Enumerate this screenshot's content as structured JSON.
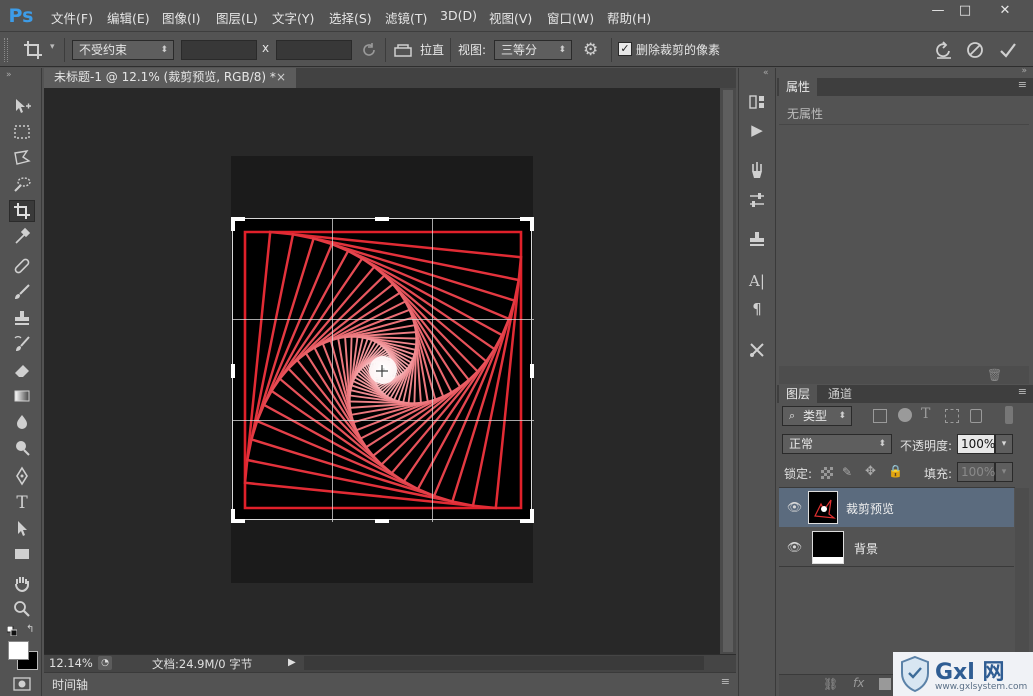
{
  "app": {
    "logo": "Ps"
  },
  "menu": [
    "文件(F)",
    "编辑(E)",
    "图像(I)",
    "图层(L)",
    "文字(Y)",
    "选择(S)",
    "滤镜(T)",
    "3D(D)",
    "视图(V)",
    "窗口(W)",
    "帮助(H)"
  ],
  "window_controls": {
    "minimize": "—",
    "maximize": "□",
    "close": "✕"
  },
  "options": {
    "ratio_select": "不受约束",
    "width_value": "",
    "x_label": "x",
    "height_value": "",
    "straighten_label": "拉直",
    "view_label": "视图:",
    "view_select": "三等分",
    "delete_pixels_label": "删除裁剪的像素",
    "delete_pixels_checked": true
  },
  "document": {
    "tab_title": "未标题-1 @ 12.1% (裁剪预览, RGB/8) *",
    "close": "×",
    "zoom": "12.14%",
    "doc_info": "文档:24.9M/0 字节"
  },
  "timeline": {
    "label": "时间轴"
  },
  "properties_panel": {
    "title": "属性",
    "empty_text": "无属性"
  },
  "layers_panel": {
    "tabs": [
      "图层",
      "通道"
    ],
    "filter_kind": "类型",
    "blend_mode": "正常",
    "opacity_label": "不透明度:",
    "opacity_value": "100%",
    "lock_label": "锁定:",
    "fill_label": "填充:",
    "fill_value": "100%",
    "layers": [
      {
        "name": "裁剪预览",
        "selected": true
      },
      {
        "name": "背景",
        "selected": false
      }
    ]
  },
  "watermark": {
    "text": "Gxl 网",
    "url": "www.gxlsystem.com"
  },
  "colors": {
    "accent": "#3d9ce8",
    "canvas": "#282828",
    "panel": "#535353",
    "selected_layer": "#5b6b7e",
    "spiral_red": "#e0202a"
  }
}
